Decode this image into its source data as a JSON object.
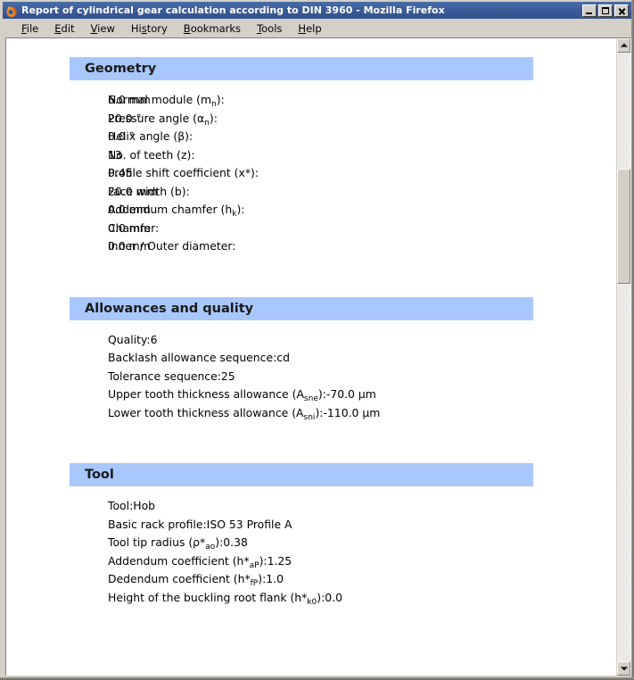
{
  "window": {
    "title": "Report of cylindrical gear calculation according to DIN 3960 - Mozilla Firefox",
    "icon": "firefox-icon",
    "controls": {
      "minimize": "Minimize",
      "maximize": "Maximize",
      "close": "Close"
    }
  },
  "menubar": {
    "items": [
      {
        "label": "File",
        "accesskey": "F"
      },
      {
        "label": "Edit",
        "accesskey": "E"
      },
      {
        "label": "View",
        "accesskey": "V"
      },
      {
        "label": "History",
        "accesskey": "s"
      },
      {
        "label": "Bookmarks",
        "accesskey": "B"
      },
      {
        "label": "Tools",
        "accesskey": "T"
      },
      {
        "label": "Help",
        "accesskey": "H"
      }
    ]
  },
  "colors": {
    "section_header_bg": "#a8c8fc",
    "titlebar_bg": "#3b5c98",
    "window_chrome": "#d4d0c8",
    "page_bg": "#ffffff",
    "text": "#000000"
  },
  "document": {
    "sections": [
      {
        "id": "geometry",
        "title": "Geometry",
        "rows": [
          {
            "label_html": "Normal module (m<sub>n</sub>):",
            "label_text": "Normal module (mn):",
            "value": "6.0 mm"
          },
          {
            "label_html": "Pressure angle (α<sub>n</sub>):",
            "label_text": "Pressure angle (αn):",
            "value": "20.0 °"
          },
          {
            "label_html": "Helix angle (β):",
            "label_text": "Helix angle (β):",
            "value": "0.0 °"
          },
          {
            "label_html": "No. of teeth (z):",
            "label_text": "No. of teeth (z):",
            "value": "13"
          },
          {
            "label_html": "Profile shift coefficient (x*):",
            "label_text": "Profile shift coefficient (x*):",
            "value": "0.45"
          },
          {
            "label_html": "Face width (b):",
            "label_text": "Face width (b):",
            "value": "20.0 mm"
          },
          {
            "label_html": "Addendum chamfer (h<sub>k</sub>):",
            "label_text": "Addendum chamfer (hk):",
            "value": "0.0 mm"
          },
          {
            "label_html": "Chamfer:",
            "label_text": "Chamfer:",
            "value": "0.0 mm"
          },
          {
            "label_html": "Inner / Outer diameter:",
            "label_text": "Inner / Outer diameter:",
            "value": "0.0 mm"
          }
        ]
      },
      {
        "id": "allowances",
        "title": "Allowances and quality",
        "rows": [
          {
            "label_html": "Quality:",
            "label_text": "Quality:",
            "value": "6"
          },
          {
            "label_html": "Backlash allowance sequence:",
            "label_text": "Backlash allowance sequence:",
            "value": "cd"
          },
          {
            "label_html": "Tolerance sequence:",
            "label_text": "Tolerance sequence:",
            "value": "25"
          },
          {
            "label_html": "Upper tooth thickness allowance (A<sub>sne</sub>):",
            "label_text": "Upper tooth thickness allowance (Asne):",
            "value": "-70.0 µm"
          },
          {
            "label_html": "Lower tooth thickness allowance (A<sub>sni</sub>):",
            "label_text": "Lower tooth thickness allowance (Asni):",
            "value": "-110.0 µm"
          }
        ]
      },
      {
        "id": "tool",
        "title": "Tool",
        "rows": [
          {
            "label_html": "Tool:",
            "label_text": "Tool:",
            "value": "Hob"
          },
          {
            "label_html": "Basic rack profile:",
            "label_text": "Basic rack profile:",
            "value": "ISO 53 Profile A"
          },
          {
            "label_html": "Tool tip radius (ρ*<sub>ao</sub>):",
            "label_text": "Tool tip radius (ρ*ao):",
            "value": "0.38"
          },
          {
            "label_html": "Addendum coefficient (h*<sub>aP</sub>):",
            "label_text": "Addendum coefficient (h*aP):",
            "value": "1.25"
          },
          {
            "label_html": "Dedendum coefficient (h*<sub>fP</sub>):",
            "label_text": "Dedendum coefficient (h*fP):",
            "value": "1.0"
          },
          {
            "label_html": "Height of the buckling root flank (h*<sub>k0</sub>):",
            "label_text": "Height of the buckling root flank (h*k0):",
            "value": "0.0"
          }
        ]
      }
    ]
  },
  "scrollbar": {
    "up_arrow": "scroll-up-arrow-icon",
    "down_arrow": "scroll-down-arrow-icon",
    "thumb_top_pct": 19,
    "thumb_height_pct": 19
  }
}
